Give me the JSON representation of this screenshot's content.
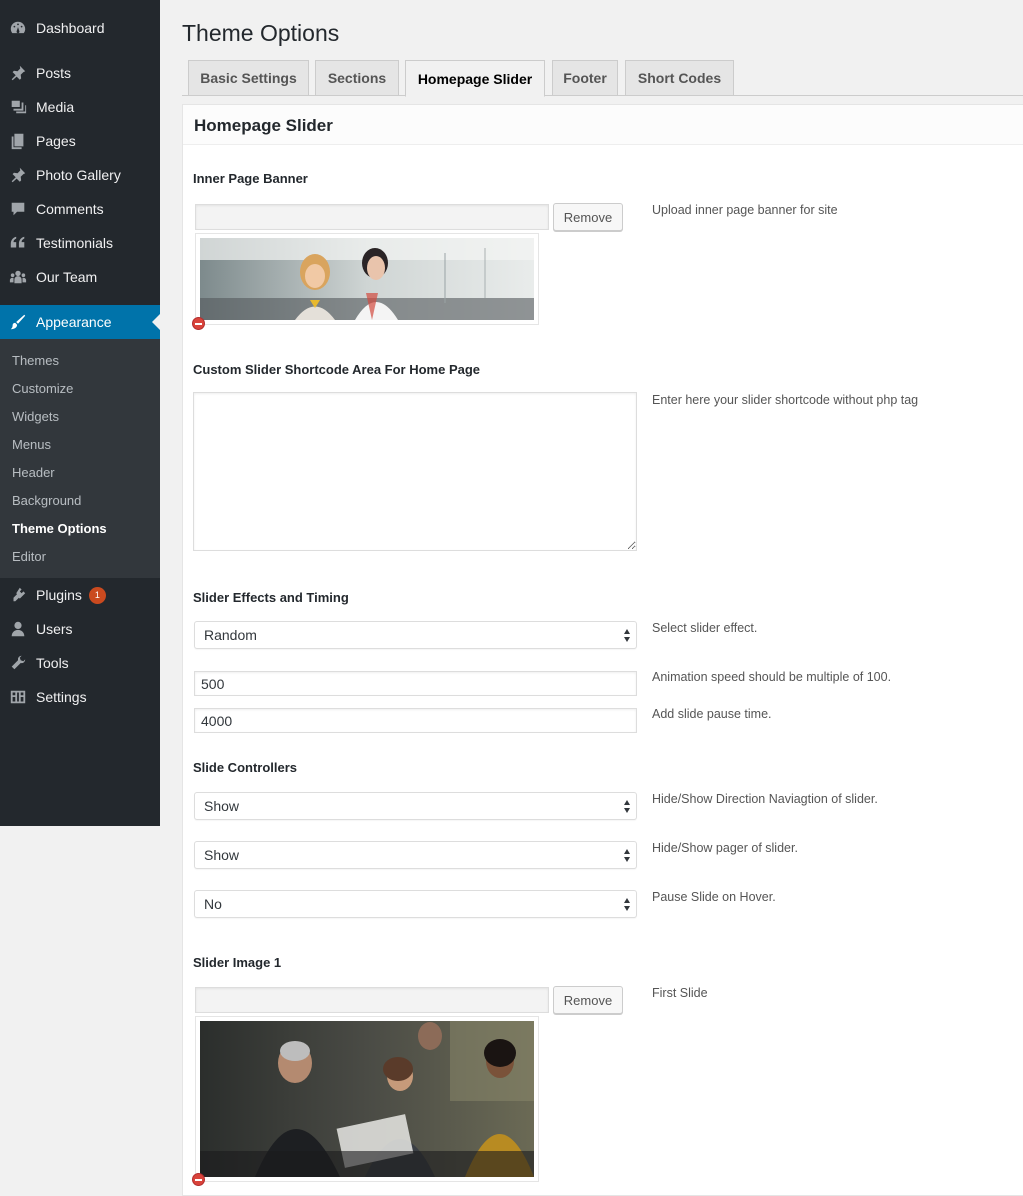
{
  "sidebar": {
    "items": [
      {
        "label": "Dashboard",
        "icon": "dashboard-icon"
      },
      {
        "label": "Posts",
        "icon": "pin-icon"
      },
      {
        "label": "Media",
        "icon": "media-icon"
      },
      {
        "label": "Pages",
        "icon": "pages-icon"
      },
      {
        "label": "Photo Gallery",
        "icon": "pin-icon"
      },
      {
        "label": "Comments",
        "icon": "comment-icon"
      },
      {
        "label": "Testimonials",
        "icon": "quote-icon"
      },
      {
        "label": "Our Team",
        "icon": "groups-icon"
      },
      {
        "label": "Appearance",
        "icon": "brush-icon"
      },
      {
        "label": "Plugins",
        "icon": "plugin-icon",
        "badge": "1"
      },
      {
        "label": "Users",
        "icon": "user-icon"
      },
      {
        "label": "Tools",
        "icon": "wrench-icon"
      },
      {
        "label": "Settings",
        "icon": "settings-icon"
      }
    ],
    "submenu": [
      "Themes",
      "Customize",
      "Widgets",
      "Menus",
      "Header",
      "Background",
      "Theme Options",
      "Editor"
    ],
    "active_color": "#0073aa",
    "background_color": "#23282d"
  },
  "page": {
    "title": "Theme Options",
    "tabs": [
      "Basic Settings",
      "Sections",
      "Homepage Slider",
      "Footer",
      "Short Codes"
    ],
    "active_tab": "Homepage Slider"
  },
  "panel": {
    "title": "Homepage Slider",
    "inner_banner": {
      "heading": "Inner Page Banner",
      "remove_label": "Remove",
      "description": "Upload inner page banner for site"
    },
    "shortcode": {
      "heading": "Custom Slider Shortcode Area For Home Page",
      "description": "Enter here your slider shortcode without php tag",
      "value": ""
    },
    "effects": {
      "heading": "Slider Effects and Timing",
      "effect_value": "Random",
      "effect_desc": "Select slider effect.",
      "speed_value": "500",
      "speed_desc": "Animation speed should be multiple of 100.",
      "pause_value": "4000",
      "pause_desc": "Add slide pause time."
    },
    "controllers": {
      "heading": "Slide Controllers",
      "direction_value": "Show",
      "direction_desc": "Hide/Show Direction Naviagtion of slider.",
      "pager_value": "Show",
      "pager_desc": "Hide/Show pager of slider.",
      "hover_value": "No",
      "hover_desc": "Pause Slide on Hover."
    },
    "slider_image_1": {
      "heading": "Slider Image 1",
      "remove_label": "Remove",
      "description": "First Slide"
    }
  }
}
